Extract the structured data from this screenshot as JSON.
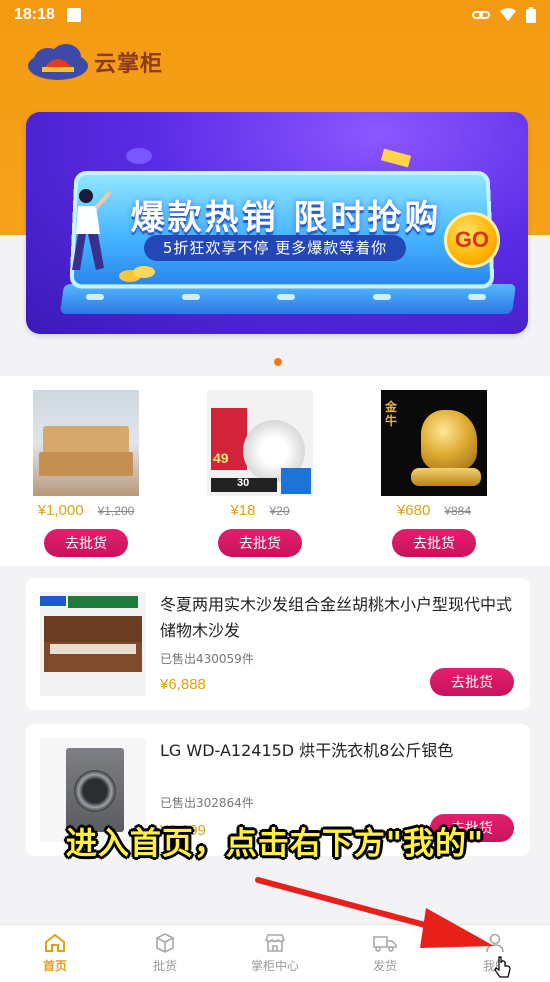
{
  "status_bar": {
    "time": "18:18"
  },
  "app": {
    "name": "云掌柜"
  },
  "banner": {
    "headline": "爆款热销 限时抢购",
    "subline": "5折狂欢享不停  更多爆款等着你",
    "go_label": "GO"
  },
  "featured_products": [
    {
      "price": "¥1,000",
      "old_price": "¥1,200",
      "button": "去批货",
      "image": "bed"
    },
    {
      "price": "¥18",
      "old_price": "¥20",
      "button": "去批货",
      "image": "smoke-detector",
      "image_text": {
        "num": "49",
        "strip": "30"
      }
    },
    {
      "price": "¥680",
      "old_price": "¥884",
      "button": "去批货",
      "image": "golden-ox",
      "image_text": {
        "chars": "金牛"
      }
    }
  ],
  "list_items": [
    {
      "title": "冬夏两用实木沙发组合金丝胡桃木小户型现代中式储物木沙发",
      "sold": "已售出430059件",
      "price": "¥6,888",
      "button": "去批货",
      "image": "sofa"
    },
    {
      "title": "LG WD-A12415D 烘干洗衣机8公斤银色",
      "sold": "已售出302864件",
      "price": "¥6,999",
      "button": "去批货",
      "image": "washing-machine"
    }
  ],
  "caption": "进入首页，点击右下方\"我的\"",
  "tabbar": [
    {
      "label": "首页",
      "icon": "home-icon",
      "active": true
    },
    {
      "label": "批货",
      "icon": "box-icon",
      "active": false
    },
    {
      "label": "掌柜中心",
      "icon": "store-icon",
      "active": false
    },
    {
      "label": "发货",
      "icon": "truck-icon",
      "active": false
    },
    {
      "label": "我的",
      "icon": "user-icon",
      "active": false
    }
  ],
  "colors": {
    "header_orange": "#f39a12",
    "accent_magenta": "#d4186a",
    "price_gold": "#e0a112",
    "caption_yellow": "#fff044",
    "arrow_red": "#e8201a"
  }
}
